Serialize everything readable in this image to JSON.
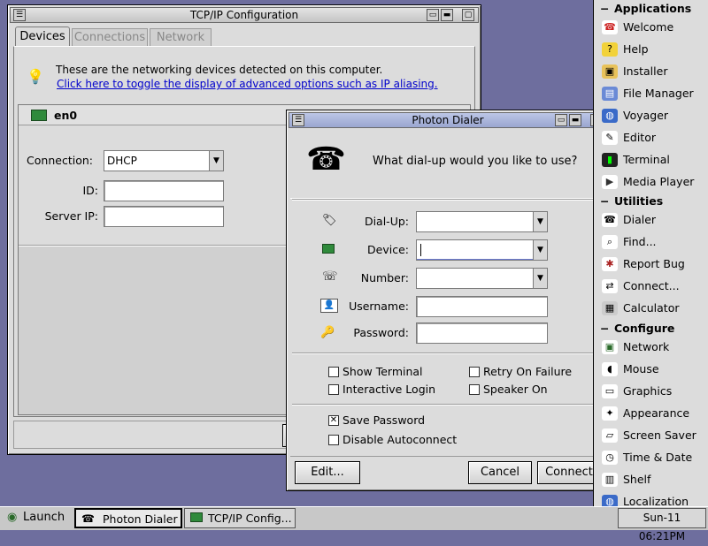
{
  "tcpip": {
    "title": "TCP/IP Configuration",
    "tabs": [
      "Devices",
      "Connections",
      "Network"
    ],
    "info_text": "These are the networking devices detected on this computer.",
    "link_text": "Click here to toggle the display of advanced options such as IP aliasing.",
    "device_name": "en0",
    "connection_label": "Connection:",
    "connection_value": "DHCP",
    "id_label": "ID:",
    "server_ip_label": "Server IP:"
  },
  "dialer": {
    "title": "Photon Dialer",
    "question": "What dial-up would you like to use?",
    "dialup_label": "Dial-Up:",
    "device_label": "Device:",
    "number_label": "Number:",
    "username_label": "Username:",
    "password_label": "Password:",
    "show_terminal": "Show Terminal",
    "retry_on_failure": "Retry On Failure",
    "interactive_login": "Interactive Login",
    "speaker_on": "Speaker On",
    "save_password": "Save Password",
    "disable_autoconnect": "Disable Autoconnect",
    "edit_button": "Edit...",
    "cancel_button": "Cancel",
    "connect_button": "Connect",
    "checked": {
      "show_terminal": false,
      "retry_on_failure": false,
      "interactive_login": false,
      "speaker_on": false,
      "save_password": true,
      "disable_autoconnect": false
    }
  },
  "shelf": {
    "applications_header": "Applications",
    "applications": [
      "Welcome",
      "Help",
      "Installer",
      "File Manager",
      "Voyager",
      "Editor",
      "Terminal",
      "Media Player"
    ],
    "utilities_header": "Utilities",
    "utilities": [
      "Dialer",
      "Find...",
      "Report Bug",
      "Connect...",
      "Calculator"
    ],
    "configure_header": "Configure",
    "configure": [
      "Network",
      "Mouse",
      "Graphics",
      "Appearance",
      "Screen Saver",
      "Time & Date",
      "Shelf",
      "Localization"
    ]
  },
  "taskbar": {
    "launch": "Launch",
    "task1": "Photon Dialer",
    "task2": "TCP/IP Config...",
    "clock": "Sun-11  06:21PM"
  },
  "colors": {
    "desktop": "#6e6e9e",
    "link": "#0000cc",
    "active_title": "#9aa6d0"
  }
}
